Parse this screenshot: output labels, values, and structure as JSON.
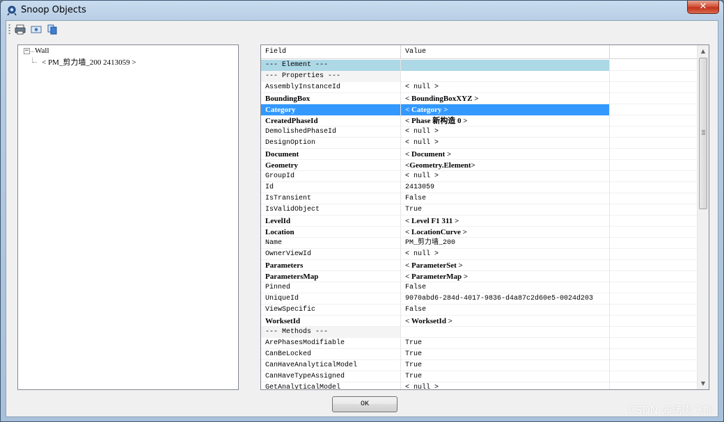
{
  "window": {
    "title": "Snoop Objects",
    "close_label": "✕"
  },
  "toolbar": {
    "buttons": [
      "print-icon",
      "print-preview-icon",
      "copy-icon"
    ]
  },
  "tree": {
    "root_label": "Wall",
    "root_expander": "−",
    "child_label": "< PM_剪力墙_200   2413059 >"
  },
  "grid": {
    "headers": {
      "field": "Field",
      "value": "Value"
    },
    "rows": [
      {
        "field": "--- Element ---",
        "value": "",
        "style": "section"
      },
      {
        "field": "   --- Properties ---",
        "value": "",
        "style": "subsection"
      },
      {
        "field": "AssemblyInstanceId",
        "value": "< null >",
        "style": ""
      },
      {
        "field": "BoundingBox",
        "value": "< BoundingBoxXYZ >",
        "style": "b"
      },
      {
        "field": "Category",
        "value": "< Category >",
        "style": "b sel"
      },
      {
        "field": "CreatedPhaseId",
        "value": "< Phase   新构造      0 >",
        "style": "b"
      },
      {
        "field": "DemolishedPhaseId",
        "value": "< null >",
        "style": ""
      },
      {
        "field": "DesignOption",
        "value": "< null >",
        "style": ""
      },
      {
        "field": "Document",
        "value": "< Document >",
        "style": "b"
      },
      {
        "field": "Geometry",
        "value": "<Geometry.Element>",
        "style": "b"
      },
      {
        "field": "GroupId",
        "value": "< null >",
        "style": ""
      },
      {
        "field": "Id",
        "value": "2413059",
        "style": ""
      },
      {
        "field": "IsTransient",
        "value": "False",
        "style": ""
      },
      {
        "field": "IsValidObject",
        "value": "True",
        "style": ""
      },
      {
        "field": "LevelId",
        "value": "< Level   F1    311 >",
        "style": "b"
      },
      {
        "field": "Location",
        "value": "< LocationCurve >",
        "style": "b"
      },
      {
        "field": "Name",
        "value": "PM_剪力墙_200",
        "style": ""
      },
      {
        "field": "OwnerViewId",
        "value": "< null >",
        "style": ""
      },
      {
        "field": "Parameters",
        "value": "< ParameterSet >",
        "style": "b"
      },
      {
        "field": "ParametersMap",
        "value": "< ParameterMap >",
        "style": "b"
      },
      {
        "field": "Pinned",
        "value": "False",
        "style": ""
      },
      {
        "field": "UniqueId",
        "value": "9070abd6-284d-4017-9836-d4a87c2d60e5-0024d203",
        "style": ""
      },
      {
        "field": "ViewSpecific",
        "value": "False",
        "style": ""
      },
      {
        "field": "WorksetId",
        "value": "< WorksetId >",
        "style": "b"
      },
      {
        "field": "   --- Methods ---",
        "value": "",
        "style": "subsection"
      },
      {
        "field": "ArePhasesModifiable",
        "value": "True",
        "style": ""
      },
      {
        "field": "CanBeLocked",
        "value": "True",
        "style": ""
      },
      {
        "field": "CanHaveAnalyticalModel",
        "value": "True",
        "style": ""
      },
      {
        "field": "CanHaveTypeAssigned",
        "value": "True",
        "style": ""
      },
      {
        "field": "GetAnalyticalModel",
        "value": "< null >",
        "style": ""
      }
    ]
  },
  "buttons": {
    "ok_label": "OK"
  },
  "watermark": "CSDN @烤肉飞熊"
}
